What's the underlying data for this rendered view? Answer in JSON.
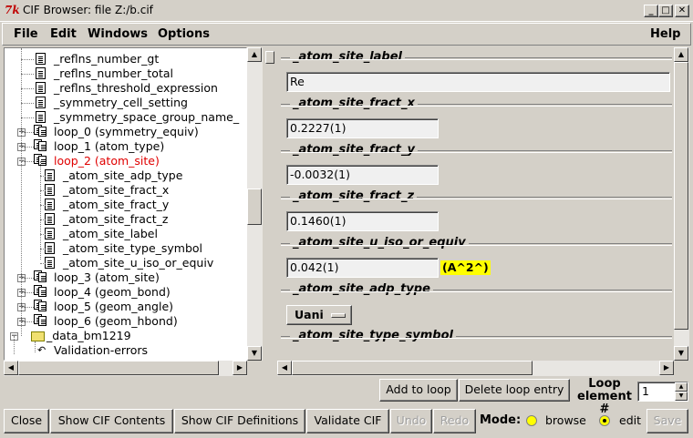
{
  "window": {
    "title": "CIF Browser: file Z:/b.cif",
    "tk_logo": "7k",
    "minimize": "_",
    "maximize": "□",
    "close": "✕"
  },
  "menu": {
    "file": "File",
    "edit": "Edit",
    "windows": "Windows",
    "options": "Options",
    "help": "Help"
  },
  "tree": {
    "items": [
      {
        "label": "_reflns_number_gt",
        "type": "doc"
      },
      {
        "label": "_reflns_number_total",
        "type": "doc"
      },
      {
        "label": "_reflns_threshold_expression",
        "type": "doc"
      },
      {
        "label": "_symmetry_cell_setting",
        "type": "doc"
      },
      {
        "label": "_symmetry_space_group_name_",
        "type": "doc"
      },
      {
        "label": "loop_0 (symmetry_equiv)",
        "type": "loop"
      },
      {
        "label": "loop_1 (atom_type)",
        "type": "loop"
      },
      {
        "label": "loop_2 (atom_site)",
        "type": "loop-open"
      },
      {
        "label": "_atom_site_adp_type",
        "type": "subdoc"
      },
      {
        "label": "_atom_site_fract_x",
        "type": "subdoc"
      },
      {
        "label": "_atom_site_fract_y",
        "type": "subdoc"
      },
      {
        "label": "_atom_site_fract_z",
        "type": "subdoc"
      },
      {
        "label": "_atom_site_label",
        "type": "subdoc"
      },
      {
        "label": "_atom_site_type_symbol",
        "type": "subdoc"
      },
      {
        "label": "_atom_site_u_iso_or_equiv",
        "type": "subdoc"
      },
      {
        "label": "loop_3 (atom_site)",
        "type": "loop"
      },
      {
        "label": "loop_4 (geom_bond)",
        "type": "loop"
      },
      {
        "label": "loop_5 (geom_angle)",
        "type": "loop"
      },
      {
        "label": "loop_6 (geom_hbond)",
        "type": "loop"
      },
      {
        "label": "_data_bm1219",
        "type": "folder"
      },
      {
        "label": "Validation-errors",
        "type": "validation"
      }
    ],
    "expand_plus": "+",
    "expand_minus": "−"
  },
  "fields": {
    "label": {
      "name": "_atom_site_label",
      "value": "Re"
    },
    "fract_x": {
      "name": "_atom_site_fract_x",
      "value": "0.2227(1)"
    },
    "fract_y": {
      "name": "_atom_site_fract_y",
      "value": "-0.0032(1)"
    },
    "fract_z": {
      "name": "_atom_site_fract_z",
      "value": "0.1460(1)"
    },
    "u_iso": {
      "name": "_atom_site_u_iso_or_equiv",
      "value": "0.042(1)",
      "unit": "(A^2^)"
    },
    "adp_type": {
      "name": "_atom_site_adp_type",
      "value": "Uani"
    },
    "type_symbol": {
      "name": "_atom_site_type_symbol"
    }
  },
  "loop_controls": {
    "add": "Add to loop",
    "delete": "Delete loop entry",
    "element_label_1": "Loop",
    "element_label_2": "element #",
    "element_value": "1"
  },
  "bottom": {
    "close": "Close",
    "show_contents": "Show CIF Contents",
    "show_definitions": "Show CIF Definitions",
    "validate": "Validate CIF",
    "undo": "Undo",
    "redo": "Redo",
    "mode_label": "Mode:",
    "browse": "browse",
    "edit": "edit",
    "save": "Save",
    "mode_selected": "edit"
  },
  "scroll": {
    "up": "▲",
    "down": "▼",
    "left": "◀",
    "right": "▶"
  },
  "colors": {
    "selected": "#e00000",
    "unit_highlight": "#ffff00",
    "radio_fill": "#ffff00"
  }
}
